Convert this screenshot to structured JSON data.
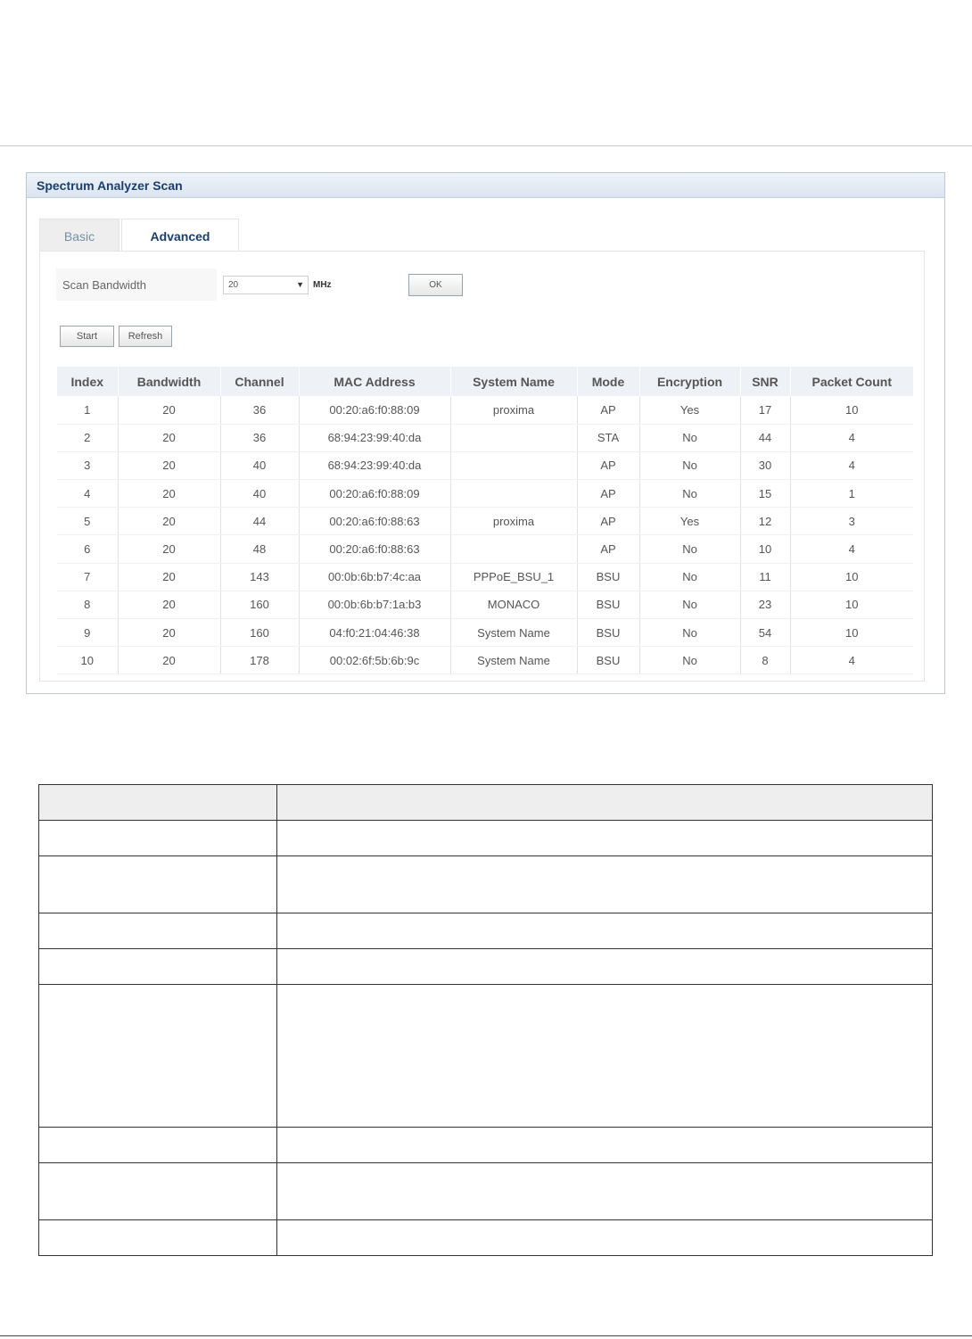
{
  "panel": {
    "title": "Spectrum Analyzer Scan",
    "tabs": [
      {
        "label": "Basic",
        "active": false
      },
      {
        "label": "Advanced",
        "active": true
      }
    ],
    "scan_bandwidth": {
      "label": "Scan Bandwidth",
      "value": "20",
      "unit": "MHz",
      "ok_label": "OK"
    },
    "buttons": {
      "start": "Start",
      "refresh": "Refresh"
    },
    "table": {
      "columns": [
        "Index",
        "Bandwidth",
        "Channel",
        "MAC Address",
        "System Name",
        "Mode",
        "Encryption",
        "SNR",
        "Packet Count"
      ],
      "rows": [
        [
          "1",
          "20",
          "36",
          "00:20:a6:f0:88:09",
          "proxima",
          "AP",
          "Yes",
          "17",
          "10"
        ],
        [
          "2",
          "20",
          "36",
          "68:94:23:99:40:da",
          "",
          "STA",
          "No",
          "44",
          "4"
        ],
        [
          "3",
          "20",
          "40",
          "68:94:23:99:40:da",
          "",
          "AP",
          "No",
          "30",
          "4"
        ],
        [
          "4",
          "20",
          "40",
          "00:20:a6:f0:88:09",
          "",
          "AP",
          "No",
          "15",
          "1"
        ],
        [
          "5",
          "20",
          "44",
          "00:20:a6:f0:88:63",
          "proxima",
          "AP",
          "Yes",
          "12",
          "3"
        ],
        [
          "6",
          "20",
          "48",
          "00:20:a6:f0:88:63",
          "",
          "AP",
          "No",
          "10",
          "4"
        ],
        [
          "7",
          "20",
          "143",
          "00:0b:6b:b7:4c:aa",
          "PPPoE_BSU_1",
          "BSU",
          "No",
          "11",
          "10"
        ],
        [
          "8",
          "20",
          "160",
          "00:0b:6b:b7:1a:b3",
          "MONACO",
          "BSU",
          "No",
          "23",
          "10"
        ],
        [
          "9",
          "20",
          "160",
          "04:f0:21:04:46:38",
          "System Name",
          "BSU",
          "No",
          "54",
          "10"
        ],
        [
          "10",
          "20",
          "178",
          "00:02:6f:5b:6b:9c",
          "System Name",
          "BSU",
          "No",
          "8",
          "4"
        ]
      ]
    }
  },
  "description_table": {
    "row_heights": [
      40,
      40,
      64,
      40,
      40,
      160,
      40,
      64,
      40
    ]
  }
}
